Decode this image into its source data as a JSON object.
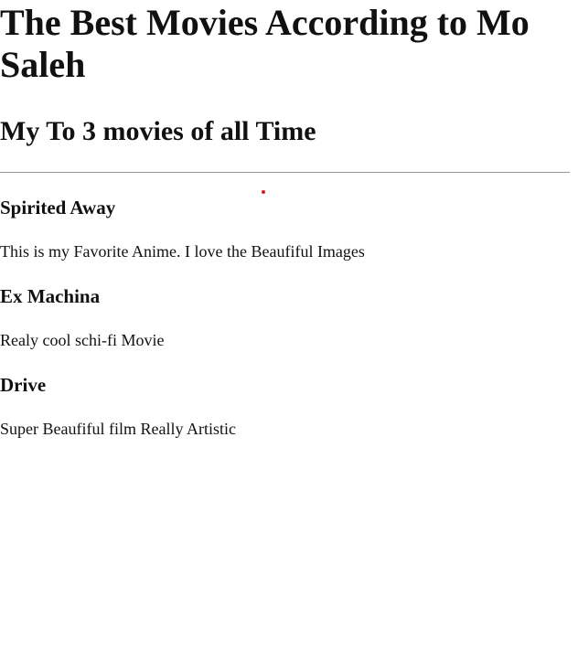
{
  "page": {
    "heading": "The Best Movies According to Mo Saleh",
    "subheading": "My To 3 movies of all Time"
  },
  "movies": [
    {
      "title": "Spirited Away",
      "description": "This is my Favorite Anime. I love the Beaufiful Images"
    },
    {
      "title": "Ex Machina",
      "description": "Realy cool schi-fi Movie"
    },
    {
      "title": "Drive",
      "description": "Super Beaufiful film Really Artistic"
    }
  ],
  "colors": {
    "text": "#111111",
    "rule": "#9a9a9a",
    "dot": "#d61f1f"
  }
}
